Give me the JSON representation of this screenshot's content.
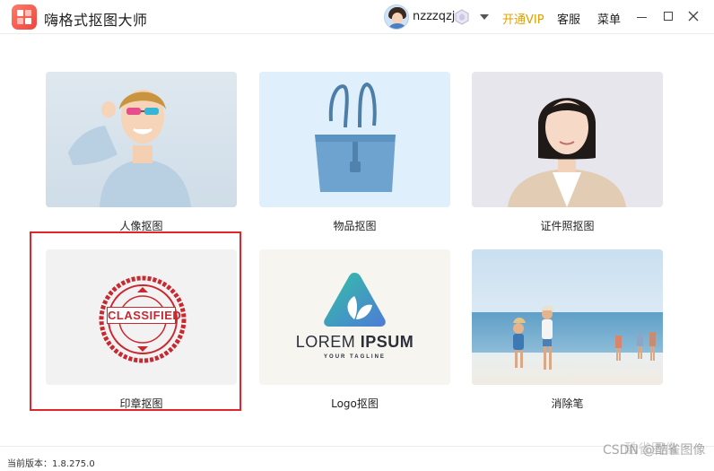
{
  "app": {
    "title": "嗨格式抠图大师"
  },
  "header": {
    "username": "nzzzqzj",
    "vip_label": "开通VIP",
    "service_label": "客服",
    "menu_label": "菜单"
  },
  "cards": [
    {
      "label": "人像抠图"
    },
    {
      "label": "物品抠图"
    },
    {
      "label": "证件照抠图"
    },
    {
      "label": "印章抠图",
      "stamp_text": "CLASSIFIED"
    },
    {
      "label": "Logo抠图",
      "logo_word_a": "LOREM ",
      "logo_word_b": "IPSUM",
      "logo_tagline": "YOUR TAGLINE"
    },
    {
      "label": "消除笔"
    }
  ],
  "footer": {
    "version": "当前版本：1.8.275.0",
    "watermark": "CSDN @酷雀图像",
    "watermark_overlay": "酷雀图像"
  },
  "colors": {
    "vip": "#e0a100",
    "highlight": "#e0262c",
    "stamp": "#c8282f"
  }
}
